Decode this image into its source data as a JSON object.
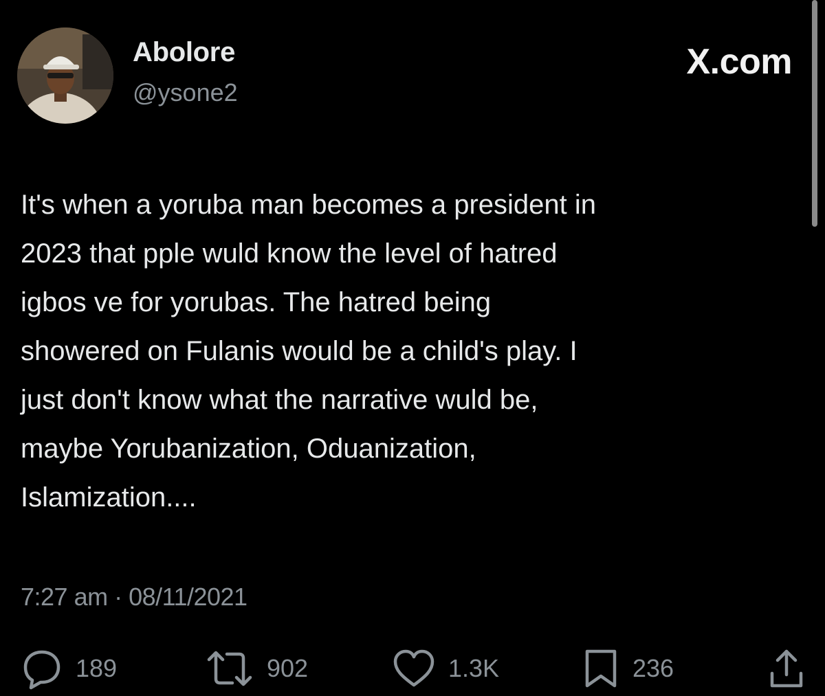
{
  "brand": {
    "label": "X.com"
  },
  "author": {
    "display_name": "Abolore",
    "handle": "@ysone2"
  },
  "tweet": {
    "text": "It's when a yoruba man becomes a president in\n2023 that pple wuld know the level of hatred\nigbos ve for yorubas. The hatred being\nshowered on Fulanis would be a child's play. I\njust don't know what the narrative wuld be,\nmaybe Yorubanization, Oduanization,\nIslamization....",
    "timestamp": "7:27 am · 08/11/2021"
  },
  "actions": {
    "replies": {
      "icon": "reply-icon",
      "count": "189"
    },
    "reposts": {
      "icon": "repost-icon",
      "count": "902"
    },
    "likes": {
      "icon": "like-icon",
      "count": "1.3K"
    },
    "bookmarks": {
      "icon": "bookmark-icon",
      "count": "236"
    },
    "share": {
      "icon": "share-icon"
    }
  },
  "colors": {
    "background": "#000000",
    "primary_text": "#e7e9ea",
    "secondary_text": "#8b9298"
  }
}
